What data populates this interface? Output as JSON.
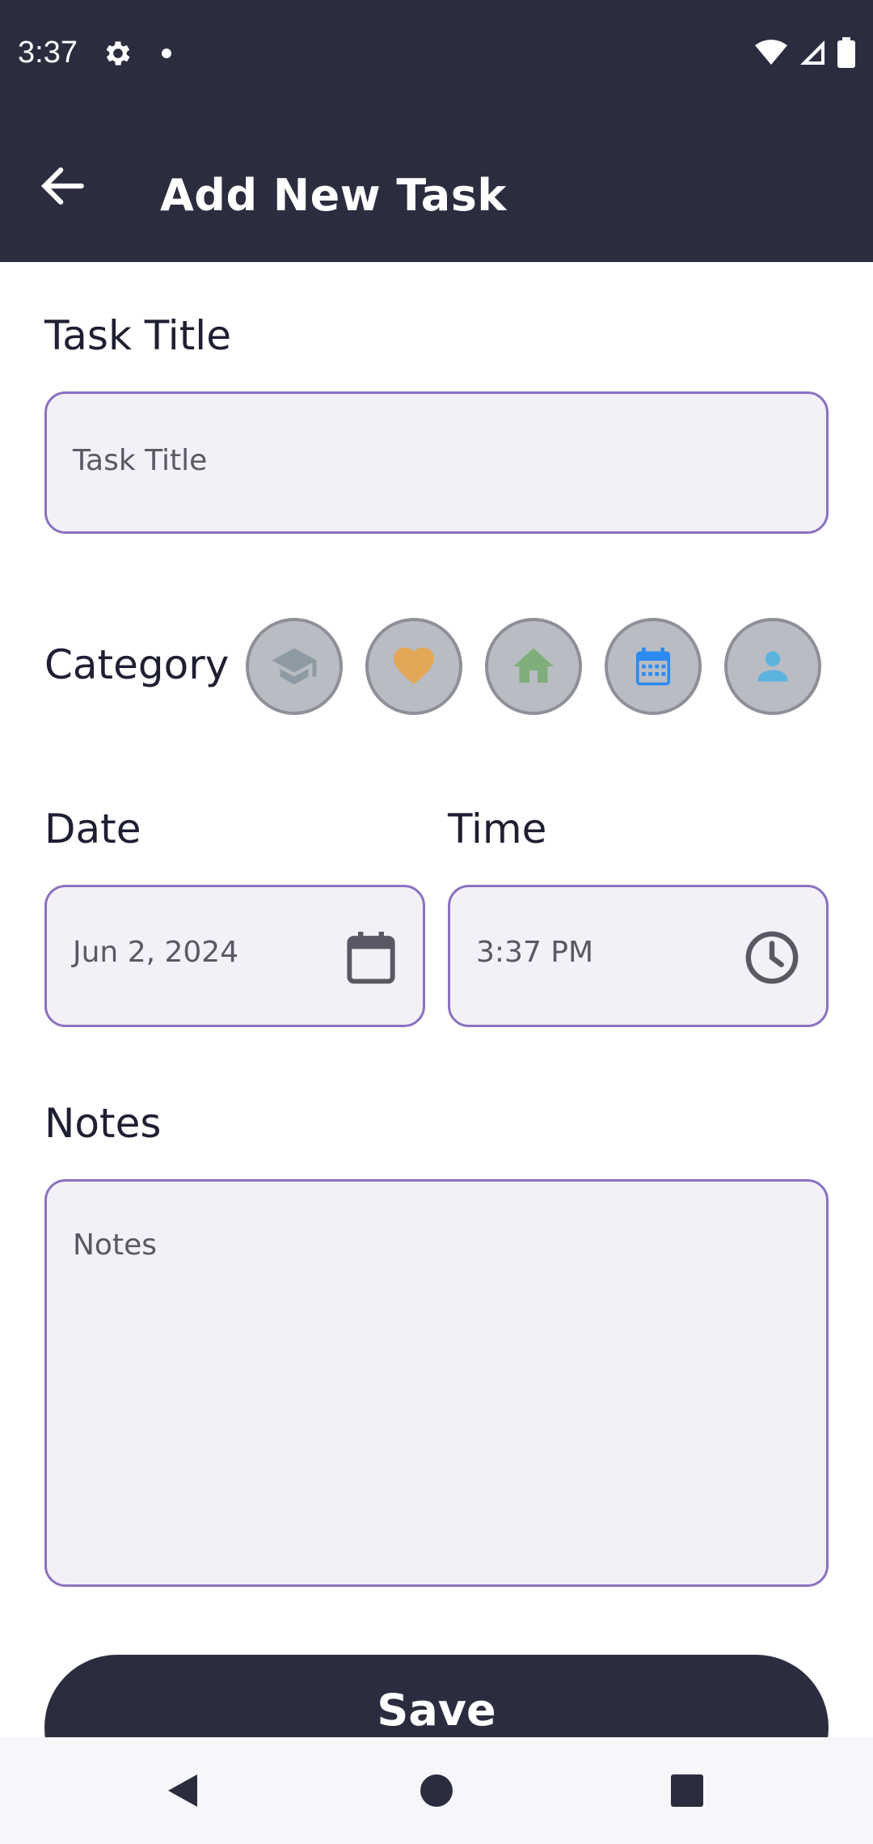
{
  "status_bar": {
    "time": "3:37"
  },
  "app_bar": {
    "title": "Add New Task"
  },
  "form": {
    "task_title_label": "Task Title",
    "task_title_placeholder": "Task Title",
    "category_label": "Category",
    "categories": [
      {
        "icon": "graduation-cap-icon",
        "color": "#8e9aa3"
      },
      {
        "icon": "heart-icon",
        "color": "#e3a857"
      },
      {
        "icon": "home-icon",
        "color": "#7fae7b"
      },
      {
        "icon": "calendar-icon",
        "color": "#2b8af0"
      },
      {
        "icon": "person-icon",
        "color": "#5db3e0"
      }
    ],
    "date_label": "Date",
    "date_value": "Jun 2, 2024",
    "time_label": "Time",
    "time_value": "3:37 PM",
    "notes_label": "Notes",
    "notes_placeholder": "Notes",
    "save_label": "Save"
  },
  "colors": {
    "header_bg": "#2b2d3f",
    "field_border": "#8a72c0",
    "field_bg": "#f3f0f8"
  }
}
